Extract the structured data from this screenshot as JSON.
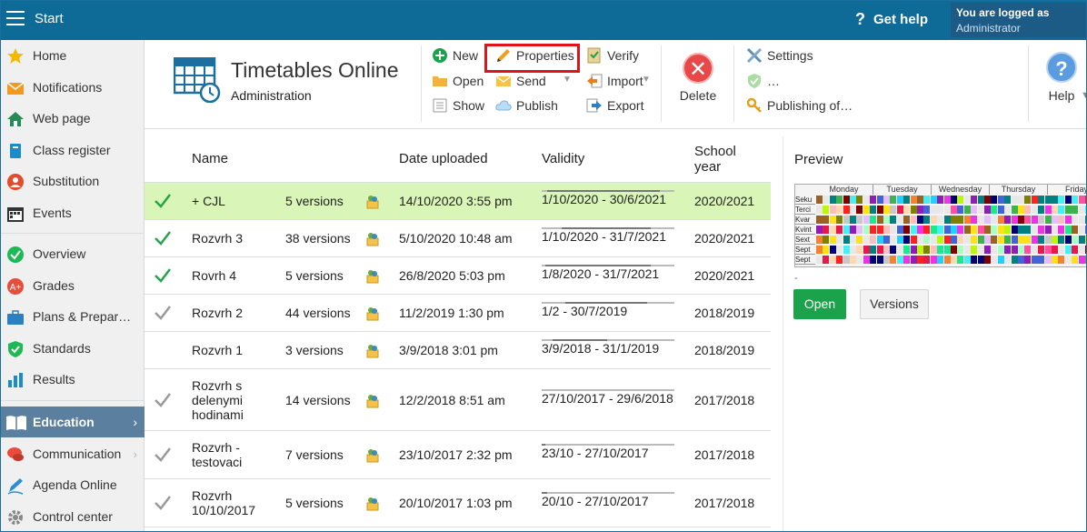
{
  "topbar": {
    "start": "Start",
    "get_help": "Get help",
    "logged_line1": "You are logged as",
    "logged_line2": "Administrator"
  },
  "sidebar": {
    "items": [
      {
        "label": "Home",
        "icon": "star-icon"
      },
      {
        "label": "Notifications",
        "icon": "envelope-icon"
      },
      {
        "label": "Web page",
        "icon": "house-icon"
      },
      {
        "label": "Class register",
        "icon": "book-icon"
      },
      {
        "label": "Substitution",
        "icon": "person-icon"
      },
      {
        "label": "Events",
        "icon": "calendar-icon"
      },
      {
        "label": "Overview",
        "icon": "check-circle-icon"
      },
      {
        "label": "Grades",
        "icon": "grade-icon"
      },
      {
        "label": "Plans & Prepar…",
        "icon": "briefcase-icon"
      },
      {
        "label": "Standards",
        "icon": "shield-icon"
      },
      {
        "label": "Results",
        "icon": "bar-chart-icon"
      },
      {
        "label": "Education",
        "icon": "open-book-icon",
        "active": true
      },
      {
        "label": "Communication",
        "icon": "chat-icon"
      },
      {
        "label": "Agenda Online",
        "icon": "pen-icon"
      },
      {
        "label": "Control center",
        "icon": "gear-icon"
      }
    ]
  },
  "ribbon": {
    "title": "Timetables Online",
    "subtitle": "Administration",
    "new": "New",
    "open": "Open",
    "show": "Show",
    "properties": "Properties",
    "send": "Send",
    "publish": "Publish",
    "verify": "Verify",
    "import": "Import",
    "export": "Export",
    "delete": "Delete",
    "settings": "Settings",
    "ellipsis": "…",
    "publishing": "Publishing of…",
    "help": "Help"
  },
  "table": {
    "headers": {
      "name": "Name",
      "date": "Date uploaded",
      "validity": "Validity",
      "school_year_1": "School",
      "school_year_2": "year"
    },
    "rows": [
      {
        "status": "green",
        "name": "+ CJL",
        "versions": "5 versions",
        "date": "14/10/2020 3:55 pm",
        "validity": "1/10/2020 - 30/6/2021",
        "year": "2020/2021"
      },
      {
        "status": "green",
        "name": "Rozvrh 3",
        "versions": "38 versions",
        "date": "5/10/2020 10:48 am",
        "validity": "1/10/2020 - 31/7/2021",
        "year": "2020/2021"
      },
      {
        "status": "green",
        "name": "Rovrh 4",
        "versions": "5 versions",
        "date": "26/8/2020 5:03 pm",
        "validity": "1/8/2020 - 31/7/2021",
        "year": "2020/2021"
      },
      {
        "status": "gray",
        "name": "Rozvrh 2",
        "versions": "44 versions",
        "date": "11/2/2019 1:30 pm",
        "validity": "1/2 - 30/7/2019",
        "year": "2018/2019"
      },
      {
        "status": "none",
        "name": "Rozvrh 1",
        "versions": "3 versions",
        "date": "3/9/2018 3:01 pm",
        "validity": "3/9/2018 - 31/1/2019",
        "year": "2018/2019"
      },
      {
        "status": "gray",
        "name": "Rozvrh s delenymi hodinami",
        "versions": "14 versions",
        "date": "12/2/2018 8:51 am",
        "validity": "27/10/2017 - 29/6/2018",
        "year": "2017/2018"
      },
      {
        "status": "gray",
        "name": "Rozvrh - testovaci",
        "versions": "7 versions",
        "date": "23/10/2017 2:32 pm",
        "validity": "23/10 - 27/10/2017",
        "year": "2017/2018"
      },
      {
        "status": "gray",
        "name": "Rozvrh 10/10/2017",
        "versions": "5 versions",
        "date": "20/10/2017 1:03 pm",
        "validity": "20/10 - 27/10/2017",
        "year": "2017/2018"
      }
    ]
  },
  "preview": {
    "title": "Preview",
    "days": [
      "Monday",
      "Tuesday",
      "Wednesday",
      "Thursday",
      "Friday"
    ],
    "classes": [
      "Seku",
      "Terci",
      "Kvar",
      "Kvint",
      "Sext",
      "Sept",
      "Sept"
    ],
    "dash": "-",
    "open": "Open",
    "versions": "Versions"
  },
  "colors": {
    "topbar": "#0e6a97",
    "selected_row": "#d9f5b7",
    "open_button": "#1aa34a",
    "highlight": "#e0121a"
  }
}
